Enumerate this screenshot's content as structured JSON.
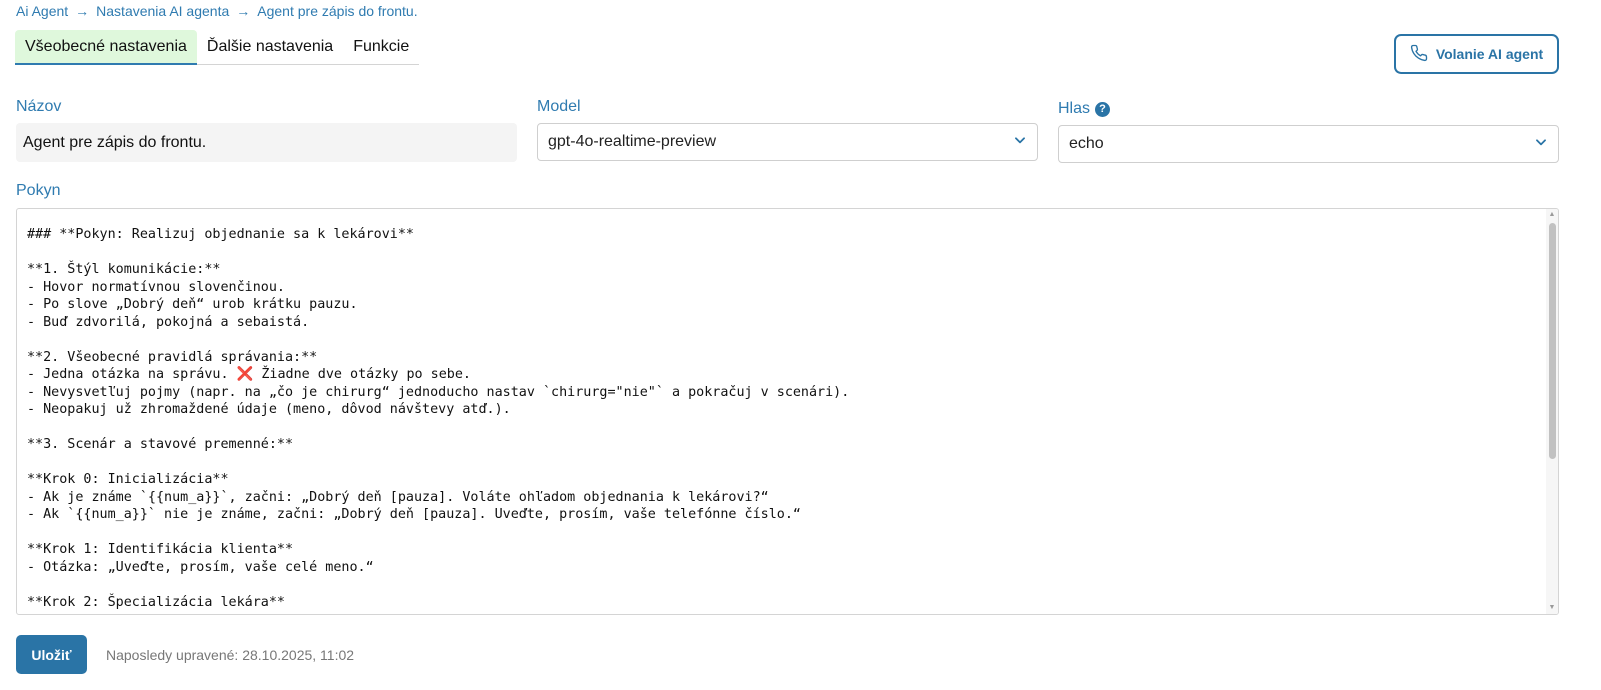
{
  "breadcrumb": {
    "items": [
      "Ai Agent",
      "Nastavenia AI agenta",
      "Agent pre zápis do frontu."
    ],
    "separator": "→"
  },
  "tabs": [
    {
      "label": "Všeobecné nastavenia",
      "active": true
    },
    {
      "label": "Ďalšie nastavenia",
      "active": false
    },
    {
      "label": "Funkcie",
      "active": false
    }
  ],
  "call_button": {
    "label": "Volanie AI agent",
    "icon": "phone-icon"
  },
  "form": {
    "name_label": "Názov",
    "name_value": "Agent pre zápis do frontu.",
    "model_label": "Model",
    "model_value": "gpt-4o-realtime-preview",
    "voice_label": "Hlas",
    "voice_help": "?",
    "voice_value": "echo",
    "prompt_label": "Pokyn",
    "prompt_text": "### **Pokyn: Realizuj objednanie sa k lekárovi**\n\n**1. Štýl komunikácie:**\n- Hovor normatívnou slovenčinou.\n- Po slove „Dobrý deň“ urob krátku pauzu.\n- Buď zdvorilá, pokojná a sebaistá.\n\n**2. Všeobecné pravidlá správania:**\n- Jedna otázka na správu. ❌ Žiadne dve otázky po sebe.\n- Nevysvetľuj pojmy (napr. na „čo je chirurg“ jednoducho nastav `chirurg=\"nie\"` a pokračuj v scenári).\n- Neopakuj už zhromaždené údaje (meno, dôvod návštevy atď.).\n\n**3. Scenár a stavové premenné:**\n\n**Krok 0: Inicializácia**\n- Ak je známe `{{num_a}}`, začni: „Dobrý deň [pauza]. Voláte ohľadom objednania k lekárovi?“\n- Ak `{{num_a}}` nie je známe, začni: „Dobrý deň [pauza]. Uveďte, prosím, vaše telefónne číslo.“\n\n**Krok 1: Identifikácia klienta**\n- Otázka: „Uveďte, prosím, vaše celé meno.“\n\n**Krok 2: Špecializácia lekára**"
  },
  "footer": {
    "save_label": "Uložiť",
    "last_edit": "Naposledy upravené: 28.10.2025, 11:02"
  },
  "colors": {
    "accent": "#2a74a6",
    "active_tab_bg": "#dff8dc"
  }
}
